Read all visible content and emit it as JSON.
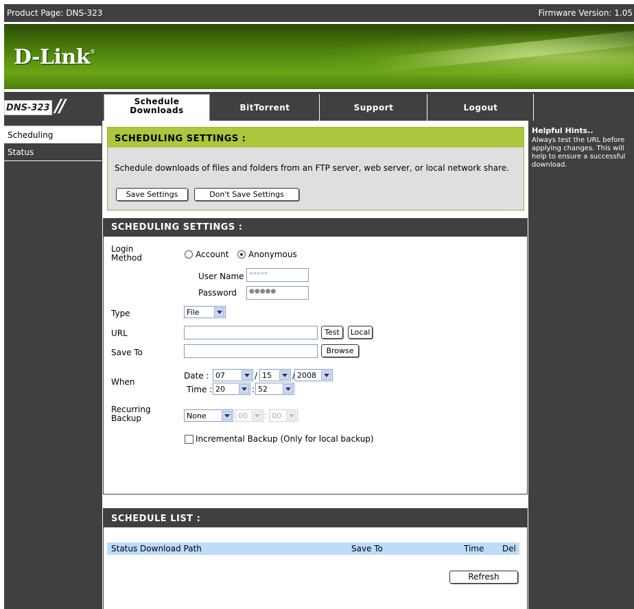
{
  "header": {
    "product_page": "Product Page: DNS-323",
    "firmware": "Firmware Version: 1.05"
  },
  "brand": {
    "logo": "D-Link",
    "trademark": "®"
  },
  "nav": {
    "model": "DNS-323",
    "slashes": "//",
    "tabs": [
      {
        "label_line1": "Schedule",
        "label_line2": "Downloads",
        "active": true
      },
      {
        "label": "BitTorrent"
      },
      {
        "label": "Support"
      },
      {
        "label": "Logout"
      }
    ]
  },
  "sidebar": {
    "items": [
      {
        "label": "Scheduling",
        "active": true
      },
      {
        "label": "Status"
      }
    ]
  },
  "hints": {
    "title": "Helpful Hints..",
    "text": "Always test the URL before applying changes. This will help to ensure a successful download."
  },
  "intro": {
    "title": "SCHEDULING SETTINGS :",
    "description": "Schedule downloads of files and folders from an FTP server, web server, or local network share.",
    "save_label": "Save Settings",
    "dont_save_label": "Don't Save Settings"
  },
  "settings": {
    "title": "SCHEDULING SETTINGS :",
    "login_method_label_1": "Login",
    "login_method_label_2": "Method",
    "account_label": "Account",
    "anonymous_label": "Anonymous",
    "login_method_selected": "Anonymous",
    "username_label": "User Name",
    "username_value": "*****",
    "password_label": "Password",
    "password_value": "●●●●●",
    "type_label": "Type",
    "type_value": "File",
    "url_label": "URL",
    "url_value": "",
    "test_label": "Test",
    "local_label": "Local",
    "save_to_label": "Save To",
    "save_to_value": "",
    "browse_label": "Browse",
    "when_label": "When",
    "date_label": "Date :",
    "month": "07",
    "day": "15",
    "year": "2008",
    "date_sep": "/",
    "time_label": "Time :",
    "hour": "20",
    "minute": "52",
    "time_sep": ":",
    "recurring_label_1": "Recurring",
    "recurring_label_2": "Backup",
    "recurring_value": "None",
    "recurring_hour": "00",
    "recurring_minute": "00",
    "incremental_label": "Incremental Backup (Only for local backup)",
    "incremental_checked": false
  },
  "schedule_list": {
    "title": "SCHEDULE LIST :",
    "columns": {
      "status_path": "Status Download Path",
      "save_to": "Save To",
      "time": "Time",
      "del": "Del"
    },
    "rows": [],
    "refresh_label": "Refresh"
  }
}
